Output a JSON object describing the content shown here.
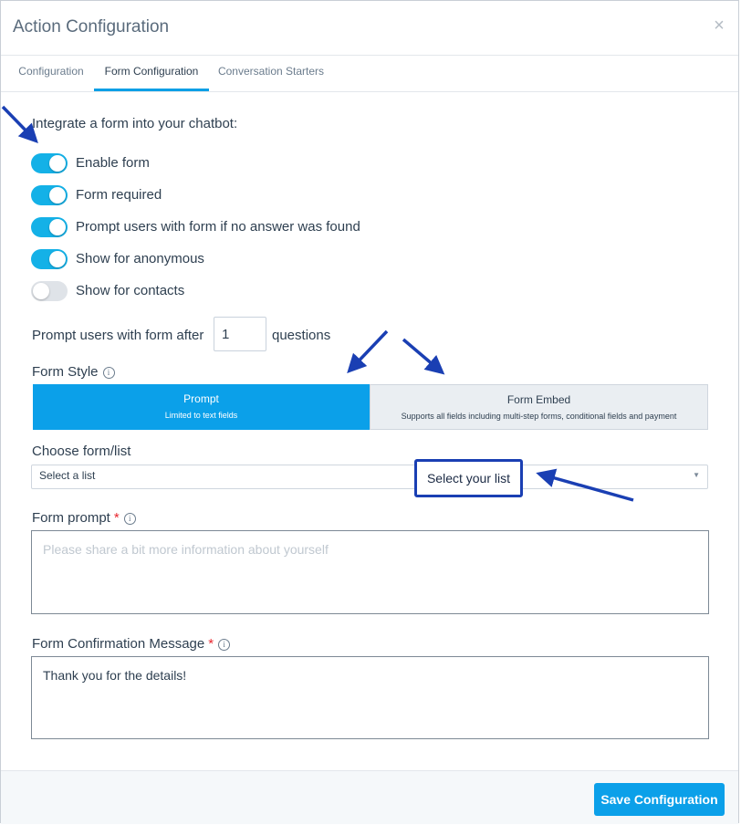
{
  "modal": {
    "title": "Action Configuration",
    "close_label": "×"
  },
  "tabs": [
    {
      "label": "Configuration"
    },
    {
      "label": "Form Configuration"
    },
    {
      "label": "Conversation Starters"
    }
  ],
  "form": {
    "intro": "Integrate a form into your chatbot:",
    "toggles": [
      {
        "label": "Enable form",
        "on": true
      },
      {
        "label": "Form required",
        "on": true
      },
      {
        "label": "Prompt users with form if no answer was found",
        "on": true
      },
      {
        "label": "Show for anonymous",
        "on": true
      },
      {
        "label": "Show for contacts",
        "on": false
      }
    ],
    "prompt_after": {
      "prefix": "Prompt users with form after",
      "value": "1",
      "suffix": "questions"
    },
    "form_style": {
      "label": "Form Style",
      "info_icon": "i",
      "options": [
        {
          "title": "Prompt",
          "subtitle": "Limited to text fields",
          "selected": true
        },
        {
          "title": "Form Embed",
          "subtitle": "Supports all fields including multi-step forms, conditional fields and payment",
          "selected": false
        }
      ]
    },
    "choose_list": {
      "label": "Choose form/list",
      "value": "Select a list",
      "caret": "▼"
    },
    "form_prompt": {
      "label": "Form prompt",
      "required_mark": "*",
      "info_icon": "i",
      "placeholder": "Please share a bit more information about yourself"
    },
    "confirmation": {
      "label": "Form Confirmation Message",
      "required_mark": "*",
      "info_icon": "i",
      "value": "Thank you for the details!"
    }
  },
  "footer": {
    "save_label": "Save Configuration"
  },
  "annotation": {
    "callout": "Select your list"
  },
  "colors": {
    "accent": "#0ba0e9",
    "toggle_on": "#14b1e7",
    "arrow": "#1a3fb3",
    "required": "#e8262e"
  },
  "icons": [
    "close-icon",
    "info-icon",
    "caret-down-icon",
    "arrow-icon"
  ]
}
